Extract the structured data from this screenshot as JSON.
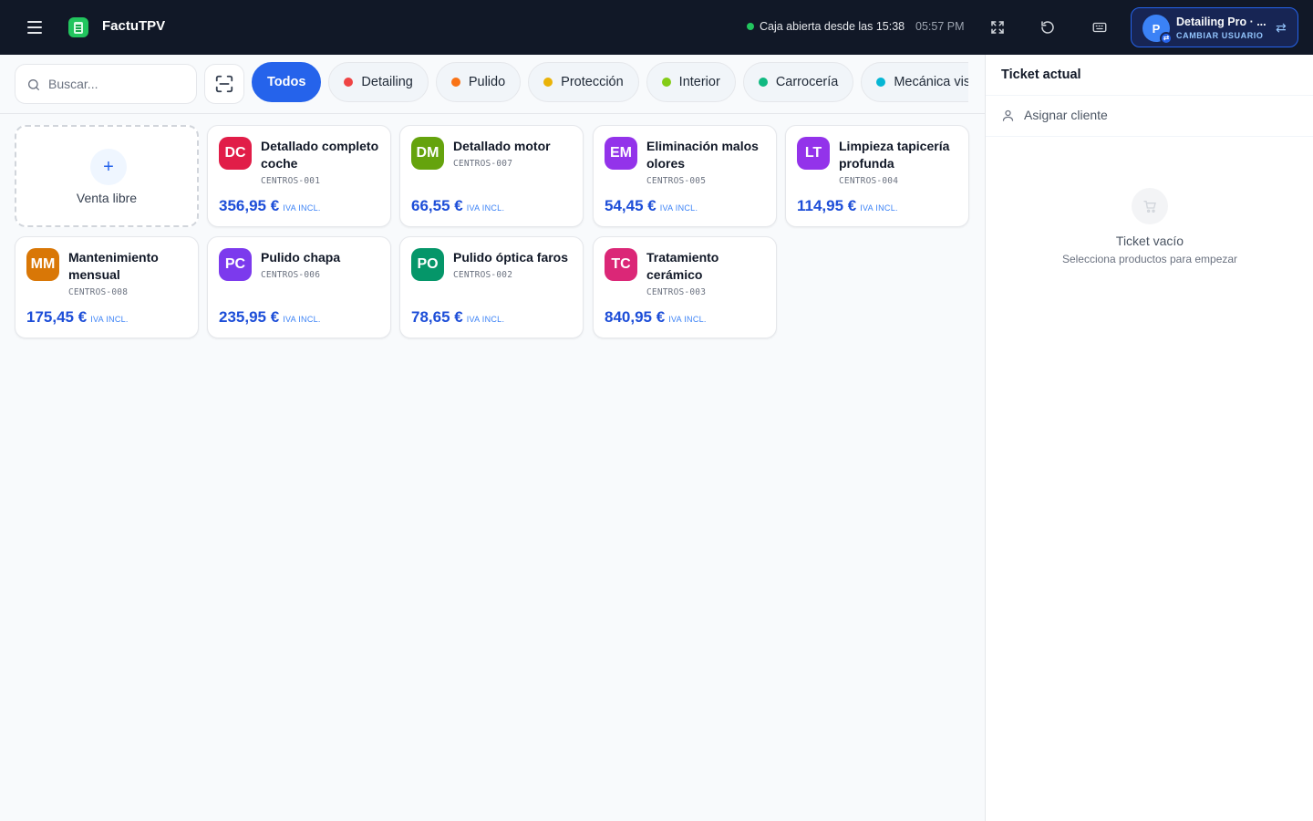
{
  "app": {
    "title": "FactuTPV"
  },
  "header": {
    "status": "Caja abierta desde las 15:38",
    "time": "05:57 PM",
    "user": {
      "initial": "P",
      "name": "Detailing Pro · ...",
      "sub": "CAMBIAR USUARIO"
    }
  },
  "search": {
    "placeholder": "Buscar..."
  },
  "categories": [
    {
      "label": "Todos",
      "color": ""
    },
    {
      "label": "Detailing",
      "color": "#ef4444"
    },
    {
      "label": "Pulido",
      "color": "#f97316"
    },
    {
      "label": "Protección",
      "color": "#eab308"
    },
    {
      "label": "Interior",
      "color": "#84cc16"
    },
    {
      "label": "Carrocería",
      "color": "#10b981"
    },
    {
      "label": "Mecánica visual",
      "color": "#06b6d4"
    }
  ],
  "free_sale": {
    "label": "Venta libre",
    "icon": "+"
  },
  "products": [
    {
      "initials": "DC",
      "name": "Detallado completo coche",
      "sku": "CENTROS-001",
      "price": "356,95 €",
      "color": "#e11d48"
    },
    {
      "initials": "DM",
      "name": "Detallado motor",
      "sku": "CENTROS-007",
      "price": "66,55 €",
      "color": "#65a30d"
    },
    {
      "initials": "EM",
      "name": "Eliminación malos olores",
      "sku": "CENTROS-005",
      "price": "54,45 €",
      "color": "#9333ea"
    },
    {
      "initials": "LT",
      "name": "Limpieza tapicería profunda",
      "sku": "CENTROS-004",
      "price": "114,95 €",
      "color": "#9333ea"
    },
    {
      "initials": "MM",
      "name": "Mantenimiento mensual",
      "sku": "CENTROS-008",
      "price": "175,45 €",
      "color": "#d97706"
    },
    {
      "initials": "PC",
      "name": "Pulido chapa",
      "sku": "CENTROS-006",
      "price": "235,95 €",
      "color": "#7c3aed"
    },
    {
      "initials": "PO",
      "name": "Pulido óptica faros",
      "sku": "CENTROS-002",
      "price": "78,65 €",
      "color": "#059669"
    },
    {
      "initials": "TC",
      "name": "Tratamiento cerámico",
      "sku": "CENTROS-003",
      "price": "840,95 €",
      "color": "#db2777"
    }
  ],
  "iva_label": "IVA INCL.",
  "ticket": {
    "title": "Ticket actual",
    "assign": "Asignar cliente",
    "empty_title": "Ticket vacío",
    "empty_sub": "Selecciona productos para empezar"
  }
}
